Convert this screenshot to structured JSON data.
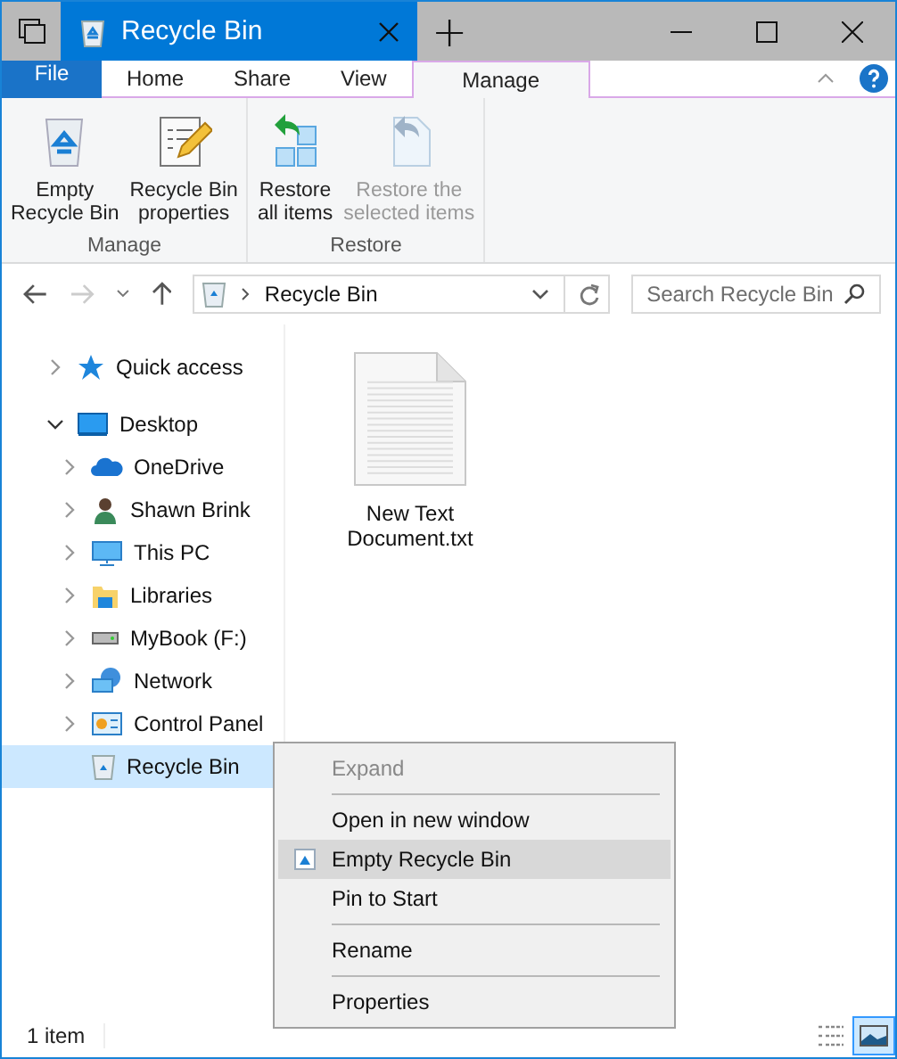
{
  "window": {
    "title": "Recycle Bin",
    "new_tab": "+"
  },
  "ribbon_tabs": [
    {
      "label": "File",
      "kind": "file",
      "selected": false
    },
    {
      "label": "Home",
      "kind": "tab",
      "selected": false
    },
    {
      "label": "Share",
      "kind": "tab",
      "selected": false
    },
    {
      "label": "View",
      "kind": "tab",
      "selected": false
    },
    {
      "label": "Manage",
      "kind": "tab",
      "selected": true
    }
  ],
  "ribbon_groups": [
    {
      "label": "Manage",
      "buttons": [
        {
          "label": "Empty\nRecycle Bin",
          "disabled": false
        },
        {
          "label": "Recycle Bin\nproperties",
          "disabled": false
        }
      ]
    },
    {
      "label": "Restore",
      "buttons": [
        {
          "label": "Restore\nall items",
          "disabled": false
        },
        {
          "label": "Restore the\nselected items",
          "disabled": true
        }
      ]
    }
  ],
  "address": {
    "path": "Recycle Bin"
  },
  "search": {
    "placeholder": "Search Recycle Bin"
  },
  "nav_tree": [
    {
      "label": "Quick access",
      "expandable": true,
      "expanded": false,
      "selected": false
    },
    {
      "label": "Desktop",
      "expandable": true,
      "expanded": true,
      "selected": false,
      "children": [
        {
          "label": "OneDrive",
          "expandable": true,
          "expanded": false,
          "selected": false
        },
        {
          "label": "Shawn Brink",
          "expandable": true,
          "expanded": false,
          "selected": false
        },
        {
          "label": "This PC",
          "expandable": true,
          "expanded": false,
          "selected": false
        },
        {
          "label": "Libraries",
          "expandable": true,
          "expanded": false,
          "selected": false
        },
        {
          "label": "MyBook (F:)",
          "expandable": true,
          "expanded": false,
          "selected": false
        },
        {
          "label": "Network",
          "expandable": true,
          "expanded": false,
          "selected": false
        },
        {
          "label": "Control Panel",
          "expandable": true,
          "expanded": false,
          "selected": false
        },
        {
          "label": "Recycle Bin",
          "expandable": false,
          "expanded": false,
          "selected": true
        }
      ]
    }
  ],
  "files": [
    {
      "name": "New Text\nDocument.txt"
    }
  ],
  "context_menu": [
    {
      "kind": "item",
      "label": "Expand",
      "disabled": true,
      "selected": false
    },
    {
      "kind": "separator"
    },
    {
      "kind": "item",
      "label": "Open in new window",
      "disabled": false,
      "selected": false
    },
    {
      "kind": "item",
      "label": "Empty Recycle Bin",
      "disabled": false,
      "selected": true
    },
    {
      "kind": "item",
      "label": "Pin to Start",
      "disabled": false,
      "selected": false
    },
    {
      "kind": "separator"
    },
    {
      "kind": "item",
      "label": "Rename",
      "disabled": false,
      "selected": false
    },
    {
      "kind": "separator"
    },
    {
      "kind": "item",
      "label": "Properties",
      "disabled": false,
      "selected": false
    }
  ],
  "status_bar": {
    "count": "1 item",
    "views": [
      {
        "kind": "details",
        "selected": false
      },
      {
        "kind": "large_icons",
        "selected": true
      }
    ]
  }
}
